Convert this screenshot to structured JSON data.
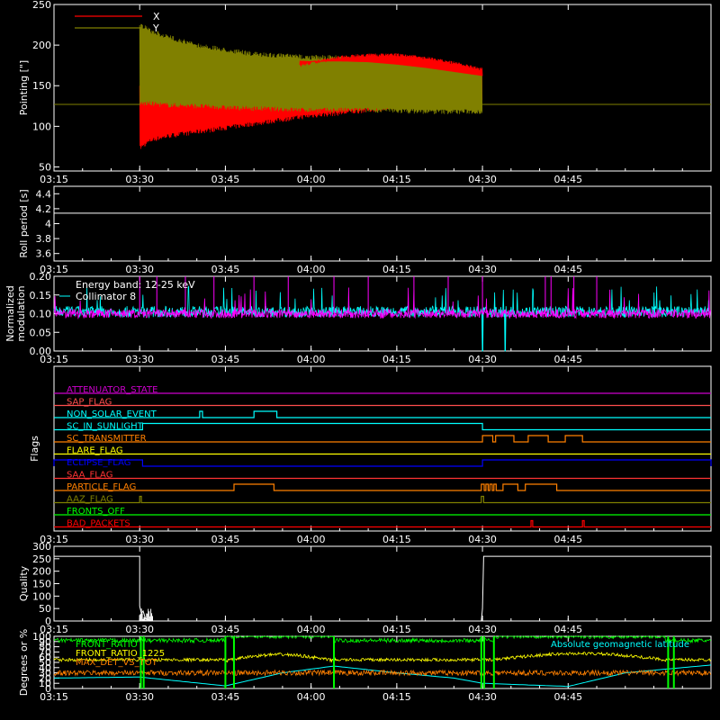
{
  "time_axis": {
    "range_min": [
      195,
      310
    ],
    "ticks": [
      "03:15",
      "03:30",
      "03:45",
      "04:00",
      "04:15",
      "04:30",
      "04:45"
    ],
    "ticks_min": [
      195,
      210,
      225,
      240,
      255,
      270,
      285
    ]
  },
  "chart_data": [
    {
      "id": "pointing",
      "type": "line",
      "ylabel": "Pointing [\"]",
      "ylim": [
        45,
        250
      ],
      "yticks": [
        50,
        100,
        150,
        200,
        250
      ],
      "legend": "top-left",
      "baseline": 127,
      "active_range_min": [
        210,
        270
      ],
      "series": [
        {
          "name": "X",
          "color": "#ff0000",
          "envelope_x_min": [
            210,
            212,
            215,
            220,
            225,
            230,
            235,
            240,
            245,
            250,
            255,
            260,
            265,
            270
          ],
          "envelope_upper": [
            150,
            150,
            150,
            155,
            160,
            165,
            172,
            180,
            187,
            190,
            190,
            186,
            180,
            172
          ],
          "envelope_lower": [
            70,
            80,
            85,
            90,
            95,
            100,
            105,
            110,
            113,
            117,
            120,
            123,
            125,
            128
          ]
        },
        {
          "name": "Y",
          "color": "#808000",
          "envelope_x_min": [
            210,
            212,
            215,
            220,
            225,
            230,
            235,
            240,
            245,
            250,
            255,
            260,
            265,
            270
          ],
          "envelope_upper": [
            228,
            220,
            213,
            203,
            197,
            192,
            190,
            188,
            188,
            187,
            184,
            180,
            175,
            170
          ],
          "envelope_lower": [
            125,
            125,
            123,
            122,
            120,
            119,
            118,
            117,
            117,
            117,
            116,
            115,
            115,
            115
          ]
        }
      ]
    },
    {
      "id": "roll",
      "type": "line",
      "ylabel": "Roll period [s]",
      "ylim": [
        3.5,
        4.5
      ],
      "yticks": [
        3.6,
        3.8,
        4.0,
        4.2,
        4.4
      ],
      "series": [
        {
          "name": "",
          "color": "#ffffff",
          "x_min": [
            195,
            310
          ],
          "values": [
            4.14,
            4.14
          ]
        }
      ]
    },
    {
      "id": "modulation",
      "type": "line",
      "ylabel": [
        "Normalized",
        "modulation"
      ],
      "ylim": [
        0,
        0.2
      ],
      "yticks": [
        0.0,
        0.05,
        0.1,
        0.15,
        0.2
      ],
      "ytick_labels": [
        "0.00",
        "0.05",
        "0.10",
        "0.15",
        "0.20"
      ],
      "legend": "top-left",
      "annotation": "Energy band: 12-25 keV",
      "series": [
        {
          "name": "Collimator 8",
          "color": "#00ffff",
          "mean": 0.105,
          "spread": 0.015
        },
        {
          "name": "",
          "color": "#ff00ff",
          "mean": 0.1,
          "spread": 0.012
        }
      ],
      "dips_x_min": [
        270,
        274
      ],
      "spikes_x_min": [
        210,
        213,
        218,
        223,
        230,
        236,
        244,
        250,
        258,
        264,
        270,
        281,
        282,
        286,
        290
      ]
    },
    {
      "id": "flags",
      "type": "line",
      "ylabel": "Flags",
      "series": [
        {
          "name": "ATTENUATOR_STATE",
          "color": "#cc00cc",
          "high": []
        },
        {
          "name": "SAP_FLAG",
          "color": "#ff4d4d",
          "high": []
        },
        {
          "name": "NON_SOLAR_EVENT",
          "color": "#00ffff",
          "high": [
            [
              220.5,
              221
            ],
            [
              230,
              234
            ]
          ]
        },
        {
          "name": "SC_IN_SUNLIGHT",
          "color": "#00ffff",
          "high": [
            [
              210.5,
              270
            ]
          ]
        },
        {
          "name": "SC_TRANSMITTER",
          "color": "#ff8000",
          "high": [
            [
              270,
              271.8
            ],
            [
              272.3,
              275.5
            ],
            [
              278,
              281.5
            ],
            [
              284.5,
              287.5
            ]
          ]
        },
        {
          "name": "FLARE_FLAG",
          "color": "#ffff00",
          "high": []
        },
        {
          "name": "ECLIPSE_FLAG",
          "color": "#0000ff",
          "high": [
            [
              195,
              210.5
            ],
            [
              270,
              310
            ]
          ]
        },
        {
          "name": "SAA_FLAG",
          "color": "#ff3333",
          "high": []
        },
        {
          "name": "PARTICLE_FLAG",
          "color": "#ff8000",
          "high": [
            [
              226.5,
              233.5
            ],
            [
              269.8,
              270.3
            ],
            [
              270.6,
              271
            ],
            [
              271.3,
              271.7
            ],
            [
              272,
              272.4
            ],
            [
              273.6,
              276.2
            ],
            [
              277.5,
              283
            ]
          ]
        },
        {
          "name": "AAZ_FLAG",
          "color": "#808000",
          "high": [
            [
              210,
              210.3
            ],
            [
              269.8,
              270.2
            ]
          ]
        },
        {
          "name": "FRONTS_OFF",
          "color": "#00ff00",
          "high": []
        },
        {
          "name": "BAD_PACKETS",
          "color": "#ff0000",
          "high": [
            [
              278.5,
              278.8
            ],
            [
              287.5,
              287.8
            ]
          ]
        }
      ]
    },
    {
      "id": "quality",
      "type": "line",
      "ylabel": "Quality",
      "ylim": [
        0,
        300
      ],
      "yticks": [
        0,
        50,
        100,
        150,
        200,
        250,
        300
      ],
      "series": [
        {
          "name": "",
          "color": "#ffffff",
          "x_min": [
            195,
            210,
            210,
            210.3,
            210.6,
            211,
            211.5,
            212,
            269.8,
            270,
            270.2,
            310
          ],
          "values": [
            260,
            260,
            60,
            30,
            40,
            10,
            5,
            0,
            0,
            50,
            260,
            260
          ]
        }
      ]
    },
    {
      "id": "ratios",
      "type": "line",
      "ylabel": "Degrees or %",
      "ylim": [
        0,
        100
      ],
      "yticks": [
        0,
        10,
        20,
        30,
        40,
        50,
        60,
        70,
        80,
        90,
        100
      ],
      "legend": "top-left",
      "series": [
        {
          "name": "FRONT_RATIO",
          "color": "#00ff00",
          "mean": 92
        },
        {
          "name": "FRONT_RATIO_1225",
          "color": "#ffff00",
          "mean": 60
        },
        {
          "name": "MAX_DET_VS_TOT",
          "color": "#ff8000",
          "mean": 30
        },
        {
          "name": "Absolute geomagnetic latitude",
          "color": "#00ffff",
          "x_min": [
            195,
            210,
            225,
            235,
            244,
            255,
            265,
            270,
            285,
            295,
            310
          ],
          "values": [
            20,
            22,
            5,
            30,
            43,
            30,
            20,
            10,
            4,
            30,
            45
          ]
        }
      ],
      "vertical_lines_x_min": [
        210.2,
        210.7,
        225,
        226.5,
        244,
        269.8,
        270.3,
        272,
        302.5,
        303.5
      ]
    }
  ]
}
